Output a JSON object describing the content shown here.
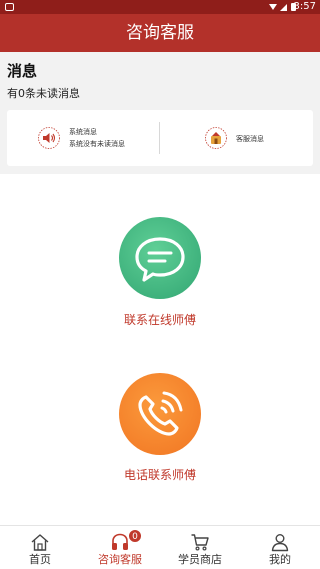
{
  "status_bar": {
    "time": "3:57"
  },
  "header": {
    "title": "咨询客服"
  },
  "messages": {
    "title": "消息",
    "count_text": "有0条未读消息",
    "system": {
      "label": "系统消息",
      "sub": "系统没有未读消息"
    },
    "service": {
      "label": "客服消息"
    }
  },
  "contacts": {
    "online": {
      "label": "联系在线师傅",
      "icon": "chat-bubble-icon",
      "color": "#3fb27d"
    },
    "phone": {
      "label": "电话联系师傅",
      "icon": "phone-icon",
      "color": "#f4802a"
    }
  },
  "tabs": [
    {
      "label": "首页",
      "icon": "home-icon",
      "active": false
    },
    {
      "label": "咨询客服",
      "icon": "headset-icon",
      "active": true,
      "badge": "0"
    },
    {
      "label": "学员商店",
      "icon": "cart-icon",
      "active": false
    },
    {
      "label": "我的",
      "icon": "user-icon",
      "active": false
    }
  ],
  "colors": {
    "brand": "#b3312a",
    "accent_text": "#c0392b"
  }
}
